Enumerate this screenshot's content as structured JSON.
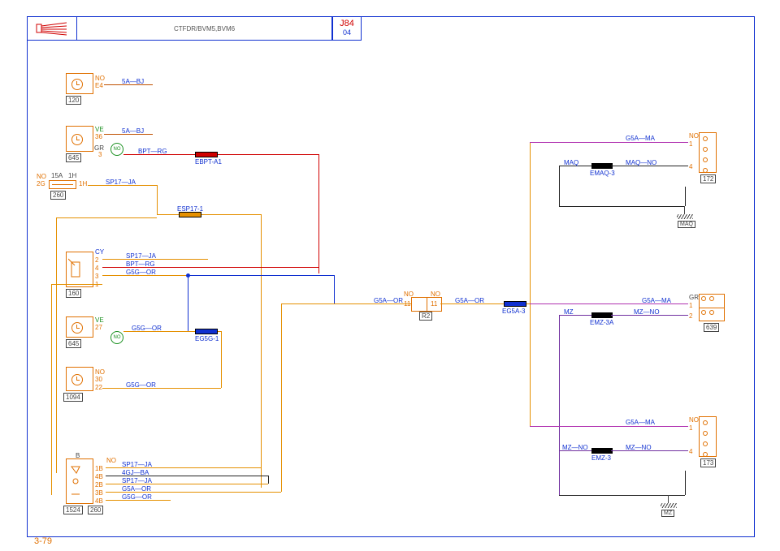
{
  "header": {
    "title_text": "CTFDR/BVM5,BVM6",
    "model": "J84",
    "sheet": "04"
  },
  "page_number": "3-79",
  "components": {
    "c120": {
      "num": "120",
      "pins": [
        {
          "n": "E4",
          "col": "NO"
        }
      ]
    },
    "c645a": {
      "num": "645",
      "pins": [
        {
          "n": "36",
          "col": "VE"
        },
        {
          "n": "3",
          "col": "GR"
        }
      ]
    },
    "c260": {
      "num": "260",
      "fuse": "15A",
      "pos": "1H",
      "pins": [
        {
          "n": "2G",
          "col": "NO"
        },
        {
          "n": "1H",
          "col": ""
        }
      ]
    },
    "c160": {
      "num": "160",
      "pins": [
        {
          "n": "2",
          "col": "CY"
        },
        {
          "n": "4",
          "col": ""
        },
        {
          "n": "3",
          "col": ""
        },
        {
          "n": "1",
          "col": ""
        }
      ]
    },
    "c645b": {
      "num": "645",
      "pins": [
        {
          "n": "27",
          "col": "VE"
        }
      ]
    },
    "c1094": {
      "num": "1094",
      "pins": [
        {
          "n": "30",
          "col": "NO"
        },
        {
          "n": "22",
          "col": ""
        }
      ]
    },
    "c1524": {
      "num": "1524",
      "side": "B",
      "pins": [
        {
          "n": "1B",
          "col": "NO"
        },
        {
          "n": "4B",
          "col": ""
        },
        {
          "n": "2B",
          "col": ""
        },
        {
          "n": "3B",
          "col": ""
        },
        {
          "n": "4B",
          "col": ""
        }
      ]
    },
    "c260b": {
      "num": "260"
    },
    "r2": {
      "num": "R2",
      "left": {
        "pin": "11",
        "col": "NO"
      },
      "right": {
        "pin": "11",
        "col": "NO"
      }
    },
    "c172": {
      "num": "172",
      "pins": [
        {
          "n": "1",
          "col": "NO"
        },
        {
          "n": "4",
          "col": ""
        }
      ]
    },
    "c639": {
      "num": "639",
      "pins": [
        {
          "n": "1",
          "col": "GR"
        },
        {
          "n": "2",
          "col": ""
        }
      ]
    },
    "c173": {
      "num": "173",
      "pins": [
        {
          "n": "1",
          "col": "NO"
        },
        {
          "n": "4",
          "col": ""
        }
      ]
    }
  },
  "grounds": {
    "maq": "MAQ",
    "mz": "MZ"
  },
  "wires": {
    "w120": "5A—BJ",
    "w645a_top": "5A—BJ",
    "w645a_bot": "BPT—RG",
    "w260": "SP17—JA",
    "w160_1": "SP17—JA",
    "w160_2": "BPT—RG",
    "w160_3": "G5G—OR",
    "w645b": "G5G—OR",
    "w1094": "G5G—OR",
    "w1524_1": "SP17—JA",
    "w1524_2": "4GJ—BA",
    "w1524_3": "SP17—JA",
    "w1524_4": "G5A—OR",
    "w1524_5": "G5G—OR",
    "wr2_l": "G5A—OR",
    "wr2_r": "G5A—OR",
    "w172_a": "G5A—MA",
    "w172_b": "MAQ",
    "w172_c": "MAQ—NO",
    "w639_a": "G5A—MA",
    "w639_b": "MZ—NO",
    "w639_c": "MZ",
    "w173_a": "G5A—MA",
    "w173_b": "MZ—NO",
    "w173_c": "MZ—NO"
  },
  "splices": {
    "s1": "EBPT-A1",
    "s2": "ESP17-1",
    "s3": "EG5G-1",
    "s4": "EG5A-3",
    "s5": "EMAQ-3",
    "s6": "EMZ-3A",
    "s7": "EMZ-3"
  },
  "markers": {
    "no": "NO"
  }
}
